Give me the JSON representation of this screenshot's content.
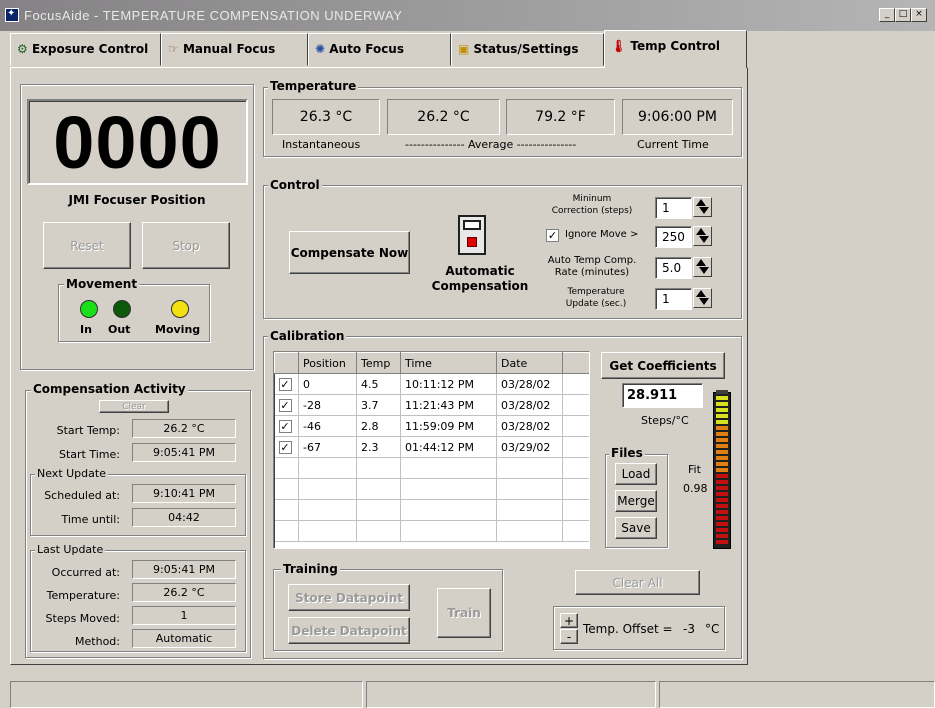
{
  "window": {
    "title": "FocusAide -  TEMPERATURE COMPENSATION UNDERWAY",
    "min_label": "_",
    "max_label": "□",
    "close_label": "×"
  },
  "tabs": [
    {
      "label": "Exposure Control",
      "icon": "exposure-icon"
    },
    {
      "label": "Manual Focus",
      "icon": "hand-pointer-icon"
    },
    {
      "label": "Auto Focus",
      "icon": "auto-focus-icon"
    },
    {
      "label": "Status/Settings",
      "icon": "status-settings-icon"
    },
    {
      "label": "Temp Control",
      "icon": "thermometer-icon"
    }
  ],
  "focuser": {
    "position": "0000",
    "label": "JMI Focuser Position",
    "reset_label": "Reset",
    "stop_label": "Stop",
    "movement_label": "Movement",
    "in_label": "In",
    "out_label": "Out",
    "moving_label": "Moving",
    "colors": {
      "in": "#00e000",
      "out": "#005000",
      "moving": "#f0e000"
    }
  },
  "compensation_activity": {
    "title": "Compensation Activity",
    "clear_label": "Clear",
    "start_temp_label": "Start Temp:",
    "start_temp": "26.2 °C",
    "start_time_label": "Start Time:",
    "start_time": "9:05:41 PM",
    "next_update_label": "Next Update",
    "scheduled_label": "Scheduled at:",
    "scheduled": "9:10:41 PM",
    "time_until_label": "Time until:",
    "time_until": "04:42",
    "last_update_label": "Last Update",
    "occurred_label": "Occurred at:",
    "occurred": "9:05:41 PM",
    "temperature_label": "Temperature:",
    "temperature": "26.2 °C",
    "steps_label": "Steps Moved:",
    "steps": "1",
    "method_label": "Method:",
    "method": "Automatic"
  },
  "temperature": {
    "title": "Temperature",
    "instantaneous": "26.3 °C",
    "average_c": "26.2 °C",
    "average_f": "79.2 °F",
    "current_time": "9:06:00 PM",
    "instantaneous_label": "Instantaneous",
    "average_label": "--------------- Average ---------------",
    "current_time_label": "Current Time"
  },
  "control": {
    "title": "Control",
    "compensate_label": "Compensate Now",
    "auto_comp_label_1": "Automatic",
    "auto_comp_label_2": "Compensation",
    "min_corr_label_1": "Mininum",
    "min_corr_label_2": "Correction (steps)",
    "min_corr_value": "1",
    "ignore_move_label": "Ignore Move >",
    "ignore_move_value": "250",
    "rate_label_1": "Auto Temp Comp.",
    "rate_label_2": "Rate (minutes)",
    "rate_value": "5.0",
    "temp_update_label_1": "Temperature",
    "temp_update_label_2": "Update (sec.)",
    "temp_update_value": "1"
  },
  "calibration": {
    "title": "Calibration",
    "columns": [
      "",
      "Position",
      "Temp",
      "Time",
      "Date"
    ],
    "rows": [
      {
        "position": "0",
        "temp": "4.5",
        "time": "10:11:12 PM",
        "date": "03/28/02"
      },
      {
        "position": "-28",
        "temp": "3.7",
        "time": "11:21:43 PM",
        "date": "03/28/02"
      },
      {
        "position": "-46",
        "temp": "2.8",
        "time": "11:59:09 PM",
        "date": "03/28/02"
      },
      {
        "position": "-67",
        "temp": "2.3",
        "time": "01:44:12 PM",
        "date": "03/29/02"
      }
    ],
    "get_coeff_label": "Get Coefficients",
    "coefficient": "28.911",
    "steps_per_c": "Steps/°C",
    "files_label": "Files",
    "load_label": "Load",
    "merge_label": "Merge",
    "save_label": "Save",
    "fit_label": "Fit",
    "fit_value": "0.98",
    "clear_all_label": "Clear All",
    "training_label": "Training",
    "store_label": "Store Datapoint",
    "delete_label": "Delete Datapoint",
    "train_label": "Train",
    "offset_plus": "+",
    "offset_minus": "-",
    "offset_label": "Temp. Offset =",
    "offset_value": "-3",
    "offset_unit": "°C",
    "fit_fraction": 0.98
  }
}
